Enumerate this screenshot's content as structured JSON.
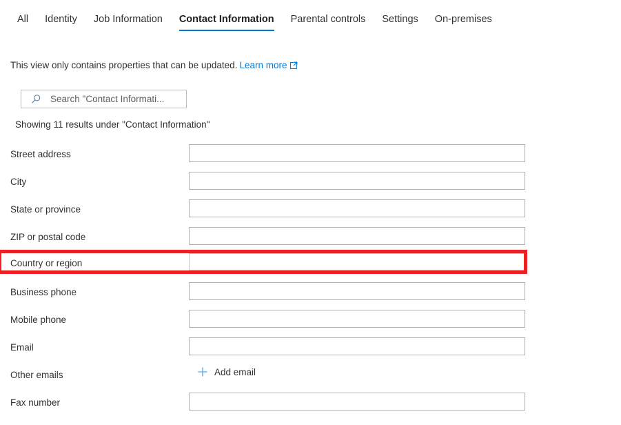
{
  "tabs": [
    {
      "label": "All",
      "selected": false
    },
    {
      "label": "Identity",
      "selected": false
    },
    {
      "label": "Job Information",
      "selected": false
    },
    {
      "label": "Contact Information",
      "selected": true
    },
    {
      "label": "Parental controls",
      "selected": false
    },
    {
      "label": "Settings",
      "selected": false
    },
    {
      "label": "On-premises",
      "selected": false
    }
  ],
  "info": {
    "text": "This view only contains properties that can be updated.",
    "link_label": "Learn more",
    "link_icon": "external-link-icon"
  },
  "search": {
    "placeholder": "Search \"Contact Informati...",
    "value": "",
    "icon": "search-icon"
  },
  "results_summary": "Showing 11 results under \"Contact Information\"",
  "form": {
    "rows": [
      {
        "label": "Street address",
        "value": "",
        "type": "text"
      },
      {
        "label": "City",
        "value": "",
        "type": "text"
      },
      {
        "label": "State or province",
        "value": "",
        "type": "text"
      },
      {
        "label": "ZIP or postal code",
        "value": "",
        "type": "text"
      },
      {
        "label": "Country or region",
        "value": "",
        "type": "text",
        "highlighted": true
      },
      {
        "label": "Business phone",
        "value": "",
        "type": "text"
      },
      {
        "label": "Mobile phone",
        "value": "",
        "type": "text"
      },
      {
        "label": "Email",
        "value": "",
        "type": "text"
      },
      {
        "label": "Other emails",
        "value": "",
        "type": "add-link",
        "add_label": "Add email",
        "add_icon": "plus-icon"
      },
      {
        "label": "Fax number",
        "value": "",
        "type": "text"
      }
    ]
  },
  "colors": {
    "accent": "#0078d4",
    "highlight_red": "#ED2024",
    "text": "#323130",
    "field_border": "#b3b3b3",
    "plus_blue": "#6cb5ee"
  }
}
